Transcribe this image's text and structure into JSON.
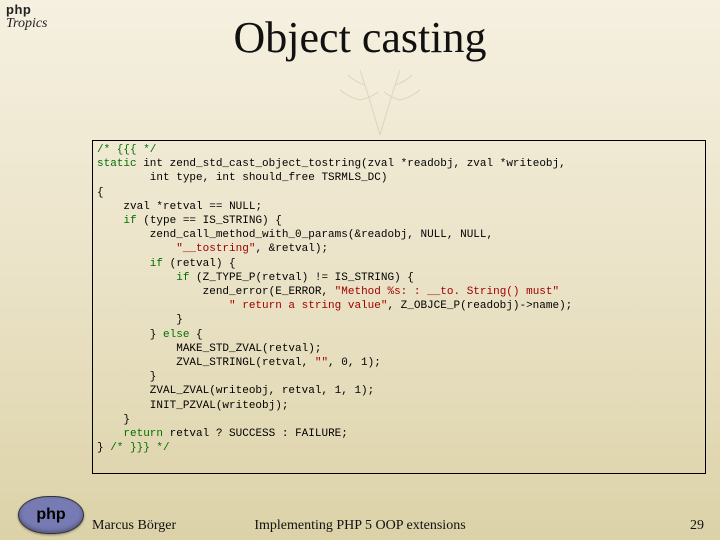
{
  "branding": {
    "top_php": "php",
    "top_tropics": "Tropics"
  },
  "title": "Object casting",
  "code": {
    "l01a": "/* {{{ */",
    "l02a": "static",
    "l02b": " int ",
    "l02c": "zend_std_cast_object_tostring(zval ",
    "l02d": "*",
    "l02e": "readobj",
    "l02f": ", ",
    "l02g": "zval ",
    "l02h": "*",
    "l02i": "writeobj",
    "l02j": ",",
    "l03a": "        int ",
    "l03b": "type",
    "l03c": ", int ",
    "l03d": "should_free ",
    "l03e": "TSRMLS_DC)",
    "l04a": "{",
    "l05a": "    zval ",
    "l05b": "*",
    "l05c": "retval ",
    "l05d": "== ",
    "l05e": "NULL;",
    "l06a": "    if ",
    "l06b": "(type ",
    "l06c": "== ",
    "l06d": "IS_STRING) {",
    "l07a": "        zend_call_method_with_0_params",
    "l07b": "(",
    "l07c": "&",
    "l07d": "readobj",
    "l07e": ", NULL, NULL,",
    "l08a": "            \"__tostring\"",
    "l08b": ", ",
    "l08c": "&",
    "l08d": "retval",
    "l08e": ");",
    "l09a": "        if ",
    "l09b": "(retval) {",
    "l10a": "            if ",
    "l10b": "(Z_TYPE_P(retval) != IS_STRING) {",
    "l11a": "                zend_error",
    "l11b": "(",
    "l11c": "E_ERROR",
    "l11d": ", ",
    "l11e": "\"Method %s: : __to. String() must\"",
    "l12a": "                    \" return a string value\"",
    "l12b": ", ",
    "l12c": "Z_OBJCE_P(readobj)->name);",
    "l13a": "            }",
    "l14a": "        } ",
    "l14b": "else ",
    "l14c": "{",
    "l15a": "            MAKE_STD_ZVAL(retval);",
    "l16a": "            ZVAL_STRINGL(retval, ",
    "l16b": "\"\"",
    "l16c": ", 0, 1);",
    "l17a": "        }",
    "l18a": "        ZVAL_ZVAL(writeobj, retval, 1, 1);",
    "l19a": "        INIT_PZVAL(writeobj);",
    "l20a": "    }",
    "l21a": "    return ",
    "l21b": "retval ",
    "l21c": "? ",
    "l21d": "SUCCESS ",
    "l21e": ": ",
    "l21f": "FAILURE;",
    "l22a": "} ",
    "l22b": "/* }}} */"
  },
  "footer": {
    "author": "Marcus Börger",
    "subject": "Implementing PHP 5 OOP extensions",
    "page": "29",
    "logo_text": "php"
  }
}
